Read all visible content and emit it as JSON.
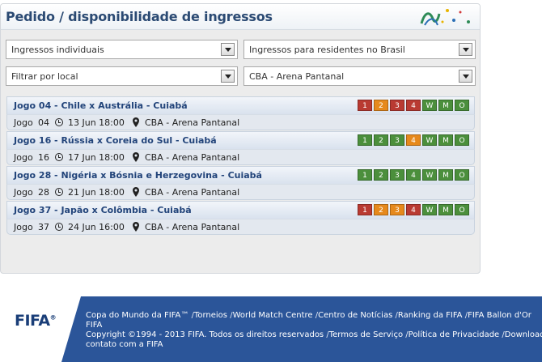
{
  "panel": {
    "title": "Pedido / disponibilidade de ingressos"
  },
  "filters": {
    "ticket_type": "Ingressos individuais",
    "residency": "Ingressos para residentes no Brasil",
    "location_filter": "Filtrar por local",
    "venue": "CBA - Arena Pantanal"
  },
  "games": [
    {
      "title": "Jogo 04 - Chile x Austrália - Cuiabá",
      "jogo_label": "Jogo",
      "number": "04",
      "date": "13 Jun 18:00",
      "venue": "CBA - Arena Pantanal",
      "cats": [
        {
          "label": "1",
          "status": "red"
        },
        {
          "label": "2",
          "status": "orange"
        },
        {
          "label": "3",
          "status": "red"
        },
        {
          "label": "4",
          "status": "red"
        },
        {
          "label": "W",
          "status": "green"
        },
        {
          "label": "M",
          "status": "green"
        },
        {
          "label": "O",
          "status": "green"
        }
      ]
    },
    {
      "title": "Jogo 16 - Rússia x Coreia do Sul - Cuiabá",
      "jogo_label": "Jogo",
      "number": "16",
      "date": "17 Jun 18:00",
      "venue": "CBA - Arena Pantanal",
      "cats": [
        {
          "label": "1",
          "status": "green"
        },
        {
          "label": "2",
          "status": "green"
        },
        {
          "label": "3",
          "status": "green"
        },
        {
          "label": "4",
          "status": "orange"
        },
        {
          "label": "W",
          "status": "green"
        },
        {
          "label": "M",
          "status": "green"
        },
        {
          "label": "O",
          "status": "green"
        }
      ]
    },
    {
      "title": "Jogo 28 - Nigéria x Bósnia e Herzegovina - Cuiabá",
      "jogo_label": "Jogo",
      "number": "28",
      "date": "21 Jun 18:00",
      "venue": "CBA - Arena Pantanal",
      "cats": [
        {
          "label": "1",
          "status": "green"
        },
        {
          "label": "2",
          "status": "green"
        },
        {
          "label": "3",
          "status": "green"
        },
        {
          "label": "4",
          "status": "green"
        },
        {
          "label": "W",
          "status": "green"
        },
        {
          "label": "M",
          "status": "green"
        },
        {
          "label": "O",
          "status": "green"
        }
      ]
    },
    {
      "title": "Jogo 37 - Japão x Colômbia - Cuiabá",
      "jogo_label": "Jogo",
      "number": "37",
      "date": "24 Jun 16:00",
      "venue": "CBA - Arena Pantanal",
      "cats": [
        {
          "label": "1",
          "status": "red"
        },
        {
          "label": "2",
          "status": "orange"
        },
        {
          "label": "3",
          "status": "orange"
        },
        {
          "label": "4",
          "status": "red"
        },
        {
          "label": "W",
          "status": "green"
        },
        {
          "label": "M",
          "status": "green"
        },
        {
          "label": "O",
          "status": "green"
        }
      ]
    }
  ],
  "colors": {
    "red": "#b93a32",
    "orange": "#e6891c",
    "green": "#4b8f3c",
    "footer": "#2b5599"
  },
  "footer": {
    "logo": "FIFA",
    "links1": [
      "Copa do Mundo da FIFA™",
      "Torneios",
      "World Match Centre",
      "Centro de Notícias",
      "Ranking da FIFA",
      "FIFA Ballon d'Or"
    ],
    "line2": "FIFA",
    "copyright": "Copyright ©1994 - 2013 FIFA. Todos os direitos reservados",
    "links2": [
      "Termos de Serviço",
      "Política de Privacidade",
      "Downloads"
    ],
    "line4": "contato com a FIFA"
  }
}
